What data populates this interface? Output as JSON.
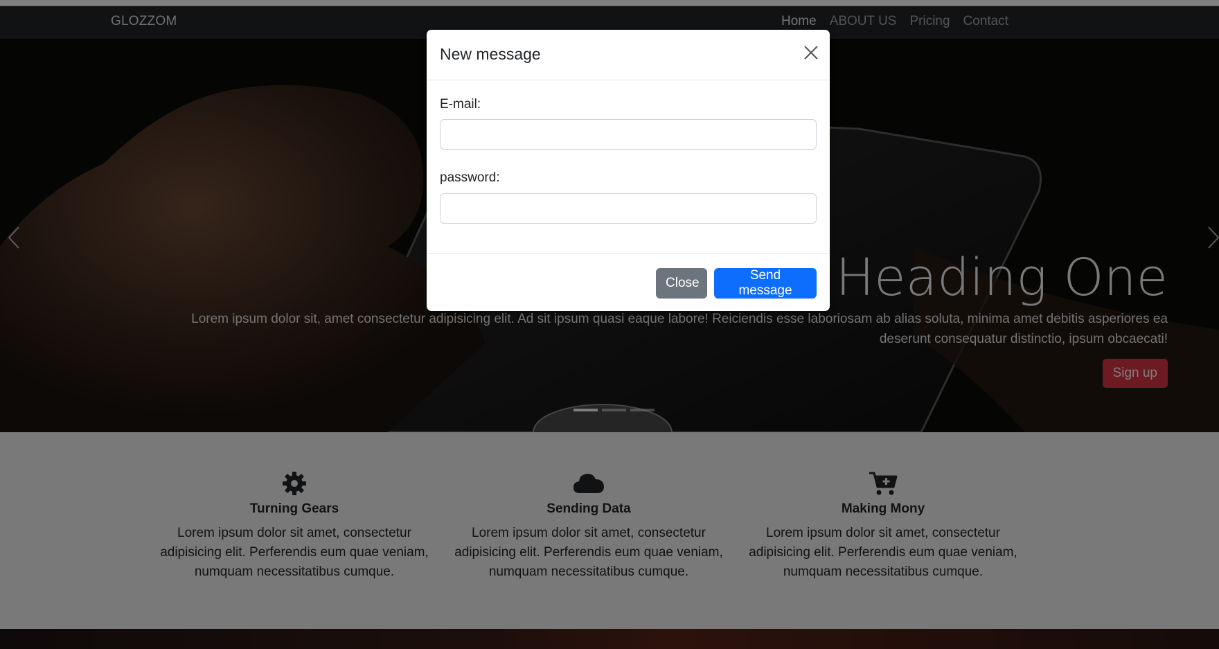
{
  "navbar": {
    "brand": "GLOZZOM",
    "links": [
      {
        "label": "Home"
      },
      {
        "label": "ABOUT US"
      },
      {
        "label": "Pricing"
      },
      {
        "label": "Contact"
      }
    ]
  },
  "hero": {
    "heading": "Heading One",
    "text": "Lorem ipsum dolor sit, amet consectetur adipisicing elit. Ad sit ipsum quasi eaque labore! Reiciendis esse laboriosam ab alias soluta, minima amet debitis asperiores ea deserunt consequatur distinctio, ipsum obcaecati!",
    "button": "Sign up",
    "slide_count": 3,
    "active_slide": 1
  },
  "features": [
    {
      "icon": "gear-icon",
      "title": "Turning Gears",
      "text": "Lorem ipsum dolor sit amet, consectetur adipisicing elit. Perferendis eum quae veniam, numquam necessitatibus cumque."
    },
    {
      "icon": "cloud-icon",
      "title": "Sending Data",
      "text": "Lorem ipsum dolor sit amet, consectetur adipisicing elit. Perferendis eum quae veniam, numquam necessitatibus cumque."
    },
    {
      "icon": "cart-plus-icon",
      "title": "Making Mony",
      "text": "Lorem ipsum dolor sit amet, consectetur adipisicing elit. Perferendis eum quae veniam, numquam necessitatibus cumque."
    }
  ],
  "modal": {
    "title": "New message",
    "email_label": "E-mail:",
    "email_value": "",
    "password_label": "password:",
    "password_value": "",
    "close_label": "Close",
    "send_label": "Send message"
  },
  "colors": {
    "navbar": "#212529",
    "primary": "#0d6efd",
    "secondary": "#6c757d",
    "danger": "#dc3545",
    "features_bg": "#f2f2f2"
  }
}
